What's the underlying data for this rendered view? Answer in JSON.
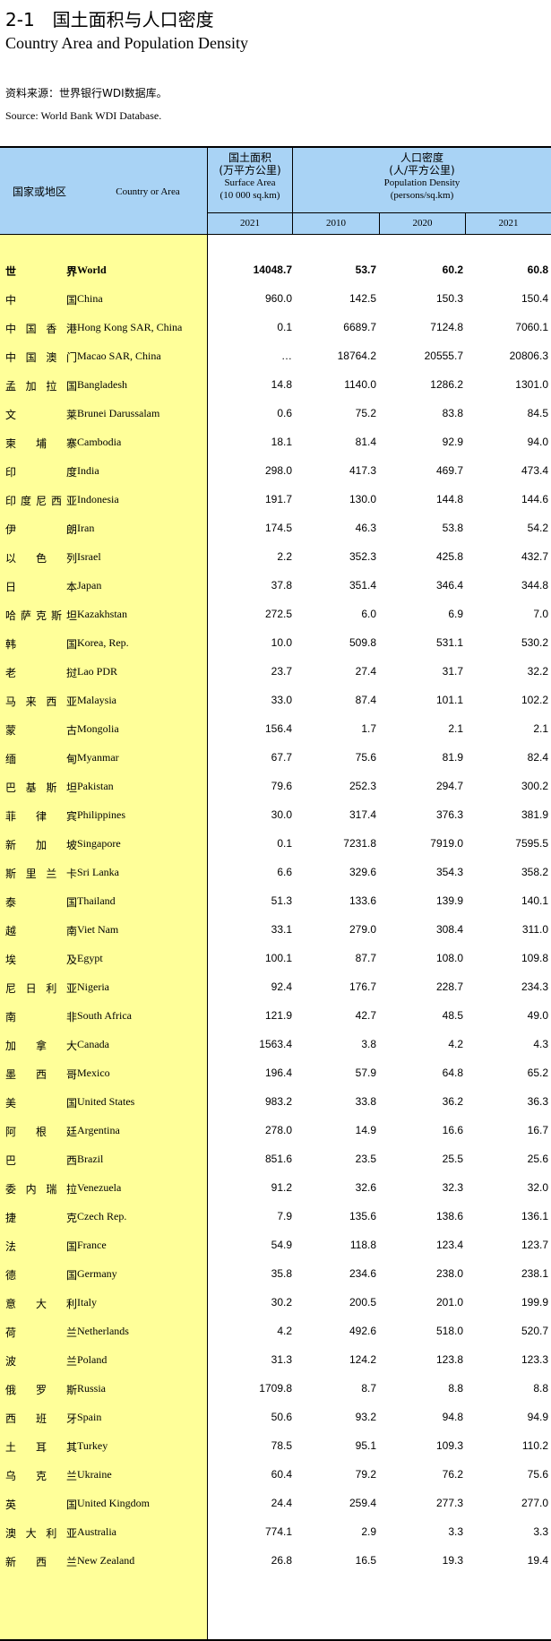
{
  "title": {
    "cn": "2-1　国土面积与人口密度",
    "en": "Country Area and Population Density"
  },
  "source": {
    "cn": "资料来源：世界银行WDI数据库。",
    "en": "Source: World Bank WDI Database."
  },
  "header": {
    "country_cn": "国家或地区",
    "country_en": "Country or Area",
    "area_cn": "国土面积",
    "area_unit_cn": "(万平方公里)",
    "area_en": "Surface Area",
    "area_unit_en": "(10 000 sq.km)",
    "density_cn": "人口密度",
    "density_unit_cn": "(人/平方公里)",
    "density_en": "Population Density",
    "density_unit_en": "(persons/sq.km)",
    "years": [
      "2021",
      "2010",
      "2020",
      "2021"
    ]
  },
  "rows": [
    {
      "cn": "世界",
      "en": "World",
      "area": "14048.7",
      "d2010": "53.7",
      "d2020": "60.2",
      "d2021": "60.8",
      "bold": true
    },
    {
      "cn": "中国",
      "en": "China",
      "area": "960.0",
      "d2010": "142.5",
      "d2020": "150.3",
      "d2021": "150.4"
    },
    {
      "cn": "中国香港",
      "en": "Hong Kong SAR, China",
      "area": "0.1",
      "d2010": "6689.7",
      "d2020": "7124.8",
      "d2021": "7060.1"
    },
    {
      "cn": "中国澳门",
      "en": "Macao SAR, China",
      "area": "…",
      "d2010": "18764.2",
      "d2020": "20555.7",
      "d2021": "20806.3"
    },
    {
      "cn": "孟加拉国",
      "en": "Bangladesh",
      "area": "14.8",
      "d2010": "1140.0",
      "d2020": "1286.2",
      "d2021": "1301.0"
    },
    {
      "cn": "文莱",
      "en": "Brunei Darussalam",
      "area": "0.6",
      "d2010": "75.2",
      "d2020": "83.8",
      "d2021": "84.5"
    },
    {
      "cn": "柬埔寨",
      "en": "Cambodia",
      "area": "18.1",
      "d2010": "81.4",
      "d2020": "92.9",
      "d2021": "94.0"
    },
    {
      "cn": "印度",
      "en": "India",
      "area": "298.0",
      "d2010": "417.3",
      "d2020": "469.7",
      "d2021": "473.4"
    },
    {
      "cn": "印度尼西亚",
      "en": "Indonesia",
      "area": "191.7",
      "d2010": "130.0",
      "d2020": "144.8",
      "d2021": "144.6"
    },
    {
      "cn": "伊朗",
      "en": "Iran",
      "area": "174.5",
      "d2010": "46.3",
      "d2020": "53.8",
      "d2021": "54.2"
    },
    {
      "cn": "以色列",
      "en": "Israel",
      "area": "2.2",
      "d2010": "352.3",
      "d2020": "425.8",
      "d2021": "432.7"
    },
    {
      "cn": "日本",
      "en": "Japan",
      "area": "37.8",
      "d2010": "351.4",
      "d2020": "346.4",
      "d2021": "344.8"
    },
    {
      "cn": "哈萨克斯坦",
      "en": "Kazakhstan",
      "area": "272.5",
      "d2010": "6.0",
      "d2020": "6.9",
      "d2021": "7.0"
    },
    {
      "cn": "韩国",
      "en": "Korea, Rep.",
      "area": "10.0",
      "d2010": "509.8",
      "d2020": "531.1",
      "d2021": "530.2"
    },
    {
      "cn": "老挝",
      "en": "Lao PDR",
      "area": "23.7",
      "d2010": "27.4",
      "d2020": "31.7",
      "d2021": "32.2"
    },
    {
      "cn": "马来西亚",
      "en": "Malaysia",
      "area": "33.0",
      "d2010": "87.4",
      "d2020": "101.1",
      "d2021": "102.2"
    },
    {
      "cn": "蒙古",
      "en": "Mongolia",
      "area": "156.4",
      "d2010": "1.7",
      "d2020": "2.1",
      "d2021": "2.1"
    },
    {
      "cn": "缅甸",
      "en": "Myanmar",
      "area": "67.7",
      "d2010": "75.6",
      "d2020": "81.9",
      "d2021": "82.4"
    },
    {
      "cn": "巴基斯坦",
      "en": "Pakistan",
      "area": "79.6",
      "d2010": "252.3",
      "d2020": "294.7",
      "d2021": "300.2"
    },
    {
      "cn": "菲律宾",
      "en": "Philippines",
      "area": "30.0",
      "d2010": "317.4",
      "d2020": "376.3",
      "d2021": "381.9"
    },
    {
      "cn": "新加坡",
      "en": "Singapore",
      "area": "0.1",
      "d2010": "7231.8",
      "d2020": "7919.0",
      "d2021": "7595.5"
    },
    {
      "cn": "斯里兰卡",
      "en": "Sri Lanka",
      "area": "6.6",
      "d2010": "329.6",
      "d2020": "354.3",
      "d2021": "358.2"
    },
    {
      "cn": "泰国",
      "en": "Thailand",
      "area": "51.3",
      "d2010": "133.6",
      "d2020": "139.9",
      "d2021": "140.1"
    },
    {
      "cn": "越南",
      "en": "Viet Nam",
      "area": "33.1",
      "d2010": "279.0",
      "d2020": "308.4",
      "d2021": "311.0"
    },
    {
      "cn": "埃及",
      "en": "Egypt",
      "area": "100.1",
      "d2010": "87.7",
      "d2020": "108.0",
      "d2021": "109.8"
    },
    {
      "cn": "尼日利亚",
      "en": "Nigeria",
      "area": "92.4",
      "d2010": "176.7",
      "d2020": "228.7",
      "d2021": "234.3"
    },
    {
      "cn": "南非",
      "en": "South Africa",
      "area": "121.9",
      "d2010": "42.7",
      "d2020": "48.5",
      "d2021": "49.0"
    },
    {
      "cn": "加拿大",
      "en": "Canada",
      "area": "1563.4",
      "d2010": "3.8",
      "d2020": "4.2",
      "d2021": "4.3"
    },
    {
      "cn": "墨西哥",
      "en": "Mexico",
      "area": "196.4",
      "d2010": "57.9",
      "d2020": "64.8",
      "d2021": "65.2"
    },
    {
      "cn": "美国",
      "en": "United States",
      "area": "983.2",
      "d2010": "33.8",
      "d2020": "36.2",
      "d2021": "36.3"
    },
    {
      "cn": "阿根廷",
      "en": "Argentina",
      "area": "278.0",
      "d2010": "14.9",
      "d2020": "16.6",
      "d2021": "16.7"
    },
    {
      "cn": "巴西",
      "en": "Brazil",
      "area": "851.6",
      "d2010": "23.5",
      "d2020": "25.5",
      "d2021": "25.6"
    },
    {
      "cn": "委内瑞拉",
      "en": "Venezuela",
      "area": "91.2",
      "d2010": "32.6",
      "d2020": "32.3",
      "d2021": "32.0"
    },
    {
      "cn": "捷克",
      "en": "Czech Rep.",
      "area": "7.9",
      "d2010": "135.6",
      "d2020": "138.6",
      "d2021": "136.1"
    },
    {
      "cn": "法国",
      "en": "France",
      "area": "54.9",
      "d2010": "118.8",
      "d2020": "123.4",
      "d2021": "123.7"
    },
    {
      "cn": "德国",
      "en": "Germany",
      "area": "35.8",
      "d2010": "234.6",
      "d2020": "238.0",
      "d2021": "238.1"
    },
    {
      "cn": "意大利",
      "en": "Italy",
      "area": "30.2",
      "d2010": "200.5",
      "d2020": "201.0",
      "d2021": "199.9"
    },
    {
      "cn": "荷兰",
      "en": "Netherlands",
      "area": "4.2",
      "d2010": "492.6",
      "d2020": "518.0",
      "d2021": "520.7"
    },
    {
      "cn": "波兰",
      "en": "Poland",
      "area": "31.3",
      "d2010": "124.2",
      "d2020": "123.8",
      "d2021": "123.3"
    },
    {
      "cn": "俄罗斯",
      "en": "Russia",
      "area": "1709.8",
      "d2010": "8.7",
      "d2020": "8.8",
      "d2021": "8.8"
    },
    {
      "cn": "西班牙",
      "en": "Spain",
      "area": "50.6",
      "d2010": "93.2",
      "d2020": "94.8",
      "d2021": "94.9"
    },
    {
      "cn": "土耳其",
      "en": "Turkey",
      "area": "78.5",
      "d2010": "95.1",
      "d2020": "109.3",
      "d2021": "110.2"
    },
    {
      "cn": "乌克兰",
      "en": "Ukraine",
      "area": "60.4",
      "d2010": "79.2",
      "d2020": "76.2",
      "d2021": "75.6"
    },
    {
      "cn": "英国",
      "en": "United Kingdom",
      "area": "24.4",
      "d2010": "259.4",
      "d2020": "277.3",
      "d2021": "277.0"
    },
    {
      "cn": "澳大利亚",
      "en": "Australia",
      "area": "774.1",
      "d2010": "2.9",
      "d2020": "3.3",
      "d2021": "3.3"
    },
    {
      "cn": "新西兰",
      "en": "New Zealand",
      "area": "26.8",
      "d2010": "16.5",
      "d2020": "19.3",
      "d2021": "19.4"
    }
  ]
}
